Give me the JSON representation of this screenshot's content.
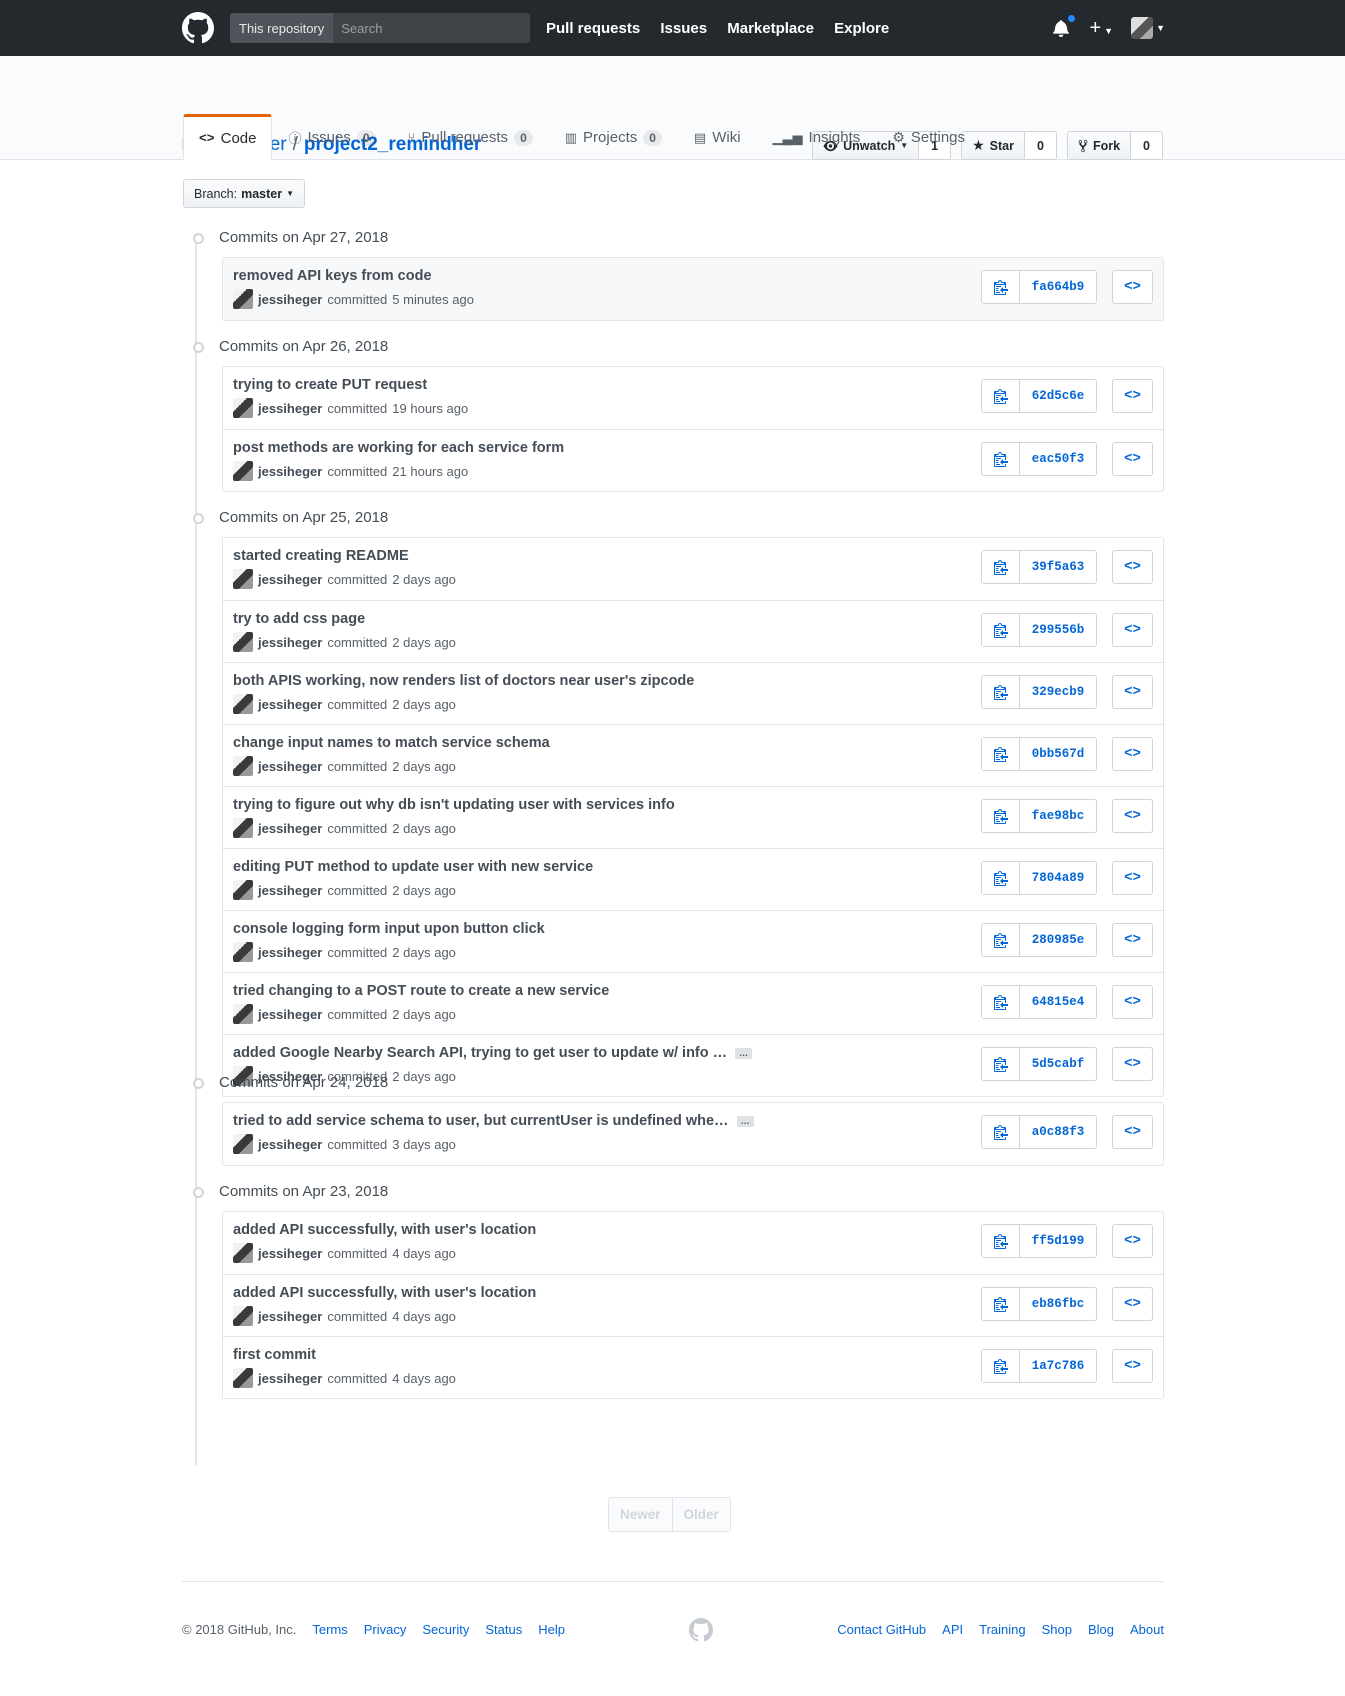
{
  "header": {
    "scope_label": "This repository",
    "search_placeholder": "Search",
    "nav": [
      "Pull requests",
      "Issues",
      "Marketplace",
      "Explore"
    ]
  },
  "repo": {
    "owner": "jessiheger",
    "separator": "/",
    "name": "project2_remindher",
    "watch_label": "Unwatch",
    "watch_count": "1",
    "star_label": "Star",
    "star_count": "0",
    "fork_label": "Fork",
    "fork_count": "0"
  },
  "tabs": [
    {
      "label": "Code",
      "count": ""
    },
    {
      "label": "Issues",
      "count": "0"
    },
    {
      "label": "Pull requests",
      "count": "0"
    },
    {
      "label": "Projects",
      "count": "0"
    },
    {
      "label": "Wiki",
      "count": ""
    },
    {
      "label": "Insights",
      "count": ""
    },
    {
      "label": "Settings",
      "count": ""
    }
  ],
  "branch": {
    "prefix": "Branch:",
    "name": "master"
  },
  "commit_groups": [
    {
      "date": "Commits on Apr 27, 2018",
      "commits": [
        {
          "message": "removed API keys from code",
          "author": "jessiheger",
          "verb": "committed",
          "time": "5 minutes ago",
          "sha": "fa664b9"
        }
      ]
    },
    {
      "date": "Commits on Apr 26, 2018",
      "commits": [
        {
          "message": "trying to create PUT request",
          "author": "jessiheger",
          "verb": "committed",
          "time": "19 hours ago",
          "sha": "62d5c6e"
        },
        {
          "message": "post methods are working for each service form",
          "author": "jessiheger",
          "verb": "committed",
          "time": "21 hours ago",
          "sha": "eac50f3"
        }
      ]
    },
    {
      "date": "Commits on Apr 25, 2018",
      "commits": [
        {
          "message": "started creating README",
          "author": "jessiheger",
          "verb": "committed",
          "time": "2 days ago",
          "sha": "39f5a63"
        },
        {
          "message": "try to add css page",
          "author": "jessiheger",
          "verb": "committed",
          "time": "2 days ago",
          "sha": "299556b"
        },
        {
          "message": "both APIS working, now renders list of doctors near user's zipcode",
          "author": "jessiheger",
          "verb": "committed",
          "time": "2 days ago",
          "sha": "329ecb9"
        },
        {
          "message": "change input names to match service schema",
          "author": "jessiheger",
          "verb": "committed",
          "time": "2 days ago",
          "sha": "0bb567d"
        },
        {
          "message": "trying to figure out why db isn't updating user with services info",
          "author": "jessiheger",
          "verb": "committed",
          "time": "2 days ago",
          "sha": "fae98bc"
        },
        {
          "message": "editing PUT method to update user with new service",
          "author": "jessiheger",
          "verb": "committed",
          "time": "2 days ago",
          "sha": "7804a89"
        },
        {
          "message": "console logging form input upon button click",
          "author": "jessiheger",
          "verb": "committed",
          "time": "2 days ago",
          "sha": "280985e"
        },
        {
          "message": "tried changing to a POST route to create a new service",
          "author": "jessiheger",
          "verb": "committed",
          "time": "2 days ago",
          "sha": "64815e4"
        },
        {
          "message": "added Google Nearby Search API, trying to get user to update w/ info …",
          "author": "jessiheger",
          "verb": "committed",
          "time": "2 days ago",
          "sha": "5d5cabf",
          "truncated": true
        }
      ]
    },
    {
      "date": "Commits on Apr 24, 2018",
      "commits": [
        {
          "message": "tried to add service schema to user, but currentUser is undefined whe…",
          "author": "jessiheger",
          "verb": "committed",
          "time": "3 days ago",
          "sha": "a0c88f3",
          "truncated": true
        }
      ]
    },
    {
      "date": "Commits on Apr 23, 2018",
      "commits": [
        {
          "message": "added API successfully, with user's location",
          "author": "jessiheger",
          "verb": "committed",
          "time": "4 days ago",
          "sha": "ff5d199"
        },
        {
          "message": "added API successfully, with user's location",
          "author": "jessiheger",
          "verb": "committed",
          "time": "4 days ago",
          "sha": "eb86fbc"
        },
        {
          "message": "first commit",
          "author": "jessiheger",
          "verb": "committed",
          "time": "4 days ago",
          "sha": "1a7c786"
        }
      ]
    }
  ],
  "ellipsis_label": "…",
  "browse_label": "<>",
  "pagination": {
    "newer": "Newer",
    "older": "Older"
  },
  "footer": {
    "copyright": "© 2018 GitHub, Inc.",
    "left_links": [
      "Terms",
      "Privacy",
      "Security",
      "Status",
      "Help"
    ],
    "right_links": [
      "Contact GitHub",
      "API",
      "Training",
      "Shop",
      "Blog",
      "About"
    ]
  },
  "colors": {
    "link": "#0366d6",
    "header_bg": "#24292e",
    "tab_accent": "#e36209"
  }
}
